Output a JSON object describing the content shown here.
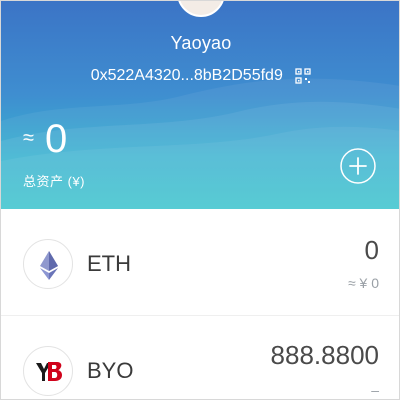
{
  "wallet": {
    "name": "Yaoyao",
    "address": "0x522A4320...8bB2D55fd9"
  },
  "total": {
    "approx_symbol": "≈",
    "value": "0",
    "label": "总资产 (¥)"
  },
  "tokens": [
    {
      "symbol": "ETH",
      "amount": "0",
      "fiat": "≈ ¥ 0",
      "icon": "ethereum-icon"
    },
    {
      "symbol": "BYO",
      "amount": "888.8800",
      "fiat": "–",
      "icon": "byo-token-icon"
    }
  ],
  "colors": {
    "header_top": "#3b74c6",
    "header_bottom": "#35c2cc",
    "text_primary": "#3a3a3a",
    "text_muted": "#9aa0a6",
    "byo_red": "#d0021b"
  }
}
